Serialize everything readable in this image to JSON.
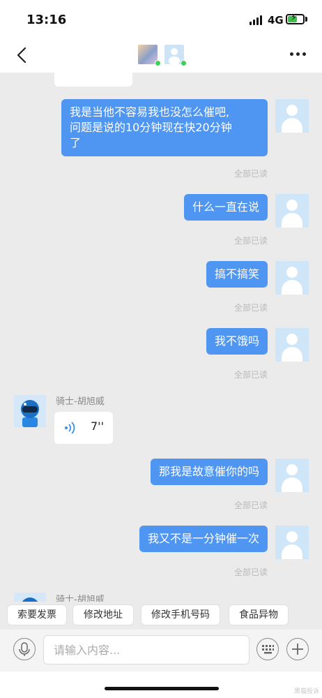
{
  "status_bar": {
    "time": "13:16",
    "network": "4G"
  },
  "chat": {
    "messages": [
      {
        "text": "我是当他不容易我也没怎么催吧,\n问题是说的10分钟现在快20分钟\n了",
        "status": "全部已读"
      },
      {
        "text": "什么一直在说",
        "status": "全部已读"
      },
      {
        "text": "搞不搞笑",
        "status": "全部已读"
      },
      {
        "text": "我不饿吗",
        "status": "全部已读"
      },
      {
        "sender": "骑士-胡旭威",
        "voice_duration": "7''"
      },
      {
        "text": "那我是故意催你的吗",
        "status": "全部已读"
      },
      {
        "text": "我又不是一分钟催一次",
        "status": "全部已读"
      },
      {
        "sender": "骑士-胡旭威"
      }
    ]
  },
  "quick_replies": [
    "索要发票",
    "修改地址",
    "修改手机号码",
    "食品异物"
  ],
  "input": {
    "placeholder": "请输入内容..."
  },
  "watermark": "黑猫投诉",
  "colors": {
    "bubble_out": "#4f95f2",
    "background": "#ebebeb",
    "read_status": "#b9b9b9",
    "online": "#3ed05a"
  }
}
